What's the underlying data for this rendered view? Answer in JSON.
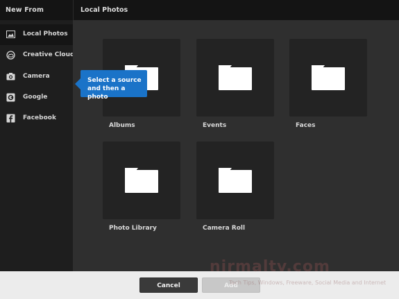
{
  "header": {
    "left_title": "New From",
    "right_title": "Local Photos"
  },
  "sidebar": {
    "items": [
      {
        "label": "Local Photos",
        "icon": "photo-icon",
        "selected": true
      },
      {
        "label": "Creative Cloud",
        "icon": "creative-cloud-icon",
        "selected": false
      },
      {
        "label": "Camera",
        "icon": "camera-icon",
        "selected": false
      },
      {
        "label": "Google",
        "icon": "google-icon",
        "selected": false
      },
      {
        "label": "Facebook",
        "icon": "facebook-icon",
        "selected": false
      }
    ]
  },
  "tooltip": {
    "text_line1": "Select a source",
    "text_line2": "and then a photo"
  },
  "folders": [
    {
      "label": "Albums",
      "icon": "folder-icon"
    },
    {
      "label": "Events",
      "icon": "folder-icon"
    },
    {
      "label": "Faces",
      "icon": "folder-icon"
    },
    {
      "label": "Photo Library",
      "icon": "folder-icon"
    },
    {
      "label": "Camera Roll",
      "icon": "folder-icon"
    }
  ],
  "footer": {
    "cancel_label": "Cancel",
    "add_label": "Add"
  },
  "watermark": {
    "main": "nirmaltv.com",
    "sub": "Tech Tips, Windows, Freeware, Social Media and Internet"
  },
  "colors": {
    "accent": "#1a73c8",
    "sidebar_bg": "#1e1e1e",
    "main_bg": "#2f2f2f",
    "tile_bg": "#232323"
  }
}
